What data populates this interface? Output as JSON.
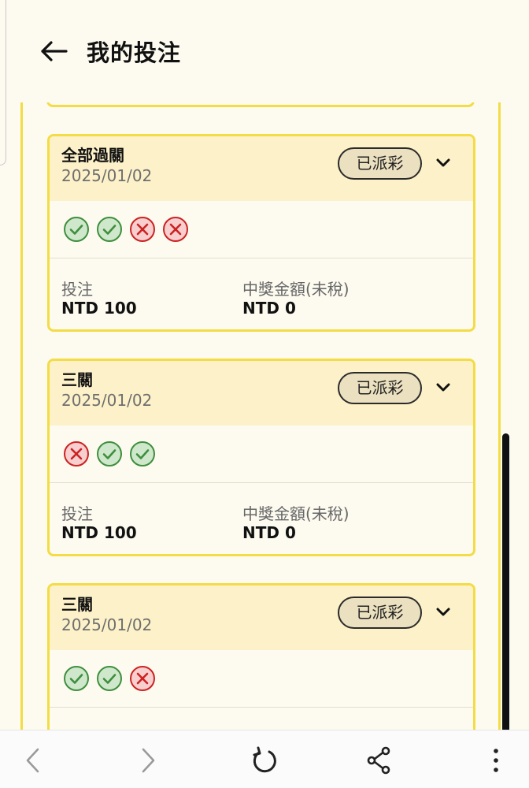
{
  "header": {
    "title": "我的投注",
    "back_icon": "arrow-left-icon"
  },
  "cards": [
    {
      "name": "全部過關",
      "date": "2025/01/02",
      "status": "已派彩",
      "results": [
        "win",
        "win",
        "lose",
        "lose"
      ],
      "stake_label": "投注",
      "stake_value": "NTD 100",
      "payout_label": "中獎金額(未稅)",
      "payout_value": "NTD 0"
    },
    {
      "name": "三關",
      "date": "2025/01/02",
      "status": "已派彩",
      "results": [
        "lose",
        "win",
        "win"
      ],
      "stake_label": "投注",
      "stake_value": "NTD 100",
      "payout_label": "中獎金額(未稅)",
      "payout_value": "NTD 0"
    },
    {
      "name": "三關",
      "date": "2025/01/02",
      "status": "已派彩",
      "results": [
        "win",
        "win",
        "lose"
      ]
    }
  ],
  "colors": {
    "accent_border": "#f3dc45",
    "card_header_bg": "#fcf1c8",
    "page_bg": "#fdfbf0",
    "win_green": "#3e8e3e",
    "lose_red": "#cc2222"
  },
  "navbar": {
    "icons": [
      "chevron-left-icon",
      "chevron-right-icon",
      "reload-icon",
      "share-icon",
      "more-vertical-icon"
    ]
  }
}
